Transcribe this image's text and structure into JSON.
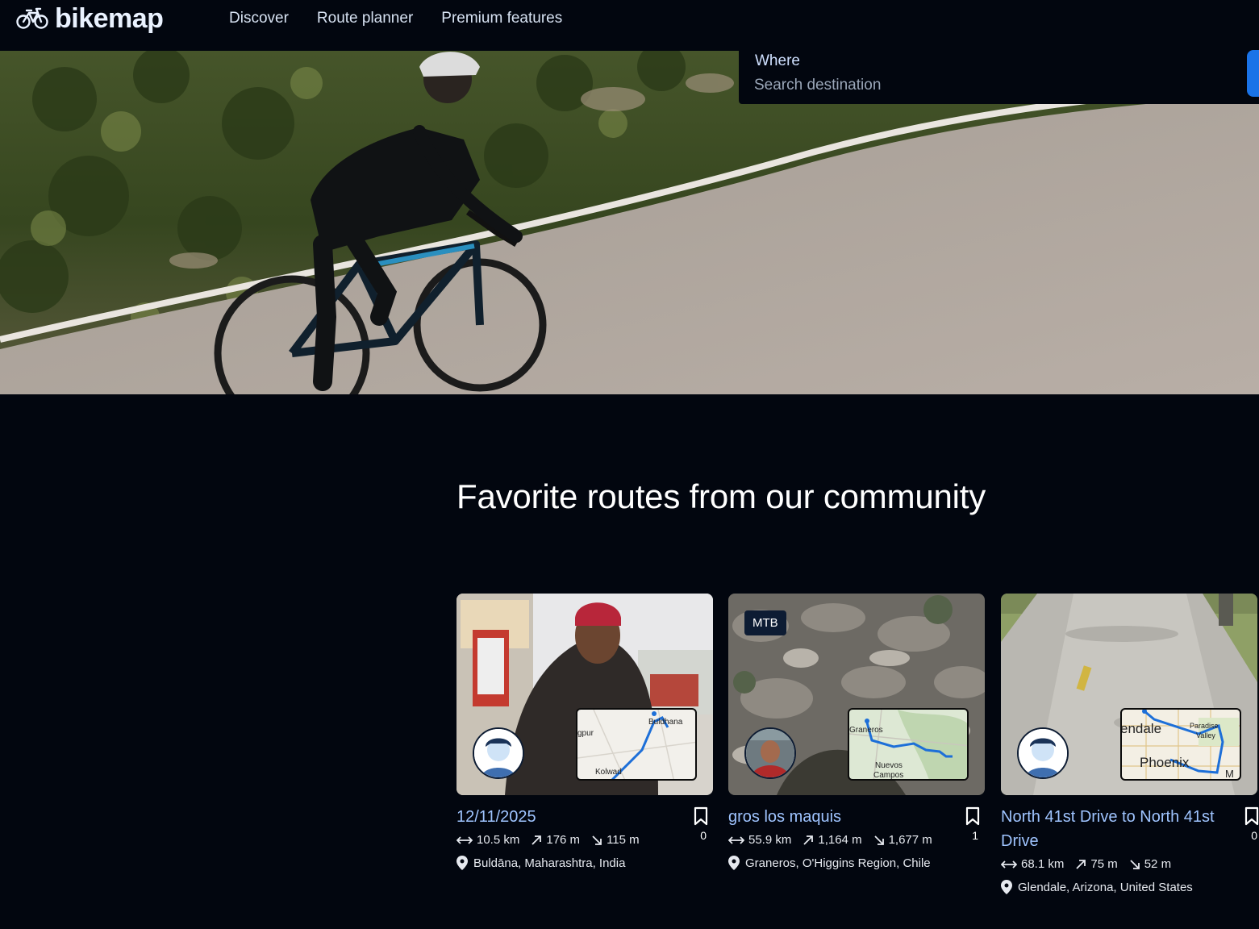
{
  "header": {
    "logo_text": "bikemap",
    "nav": [
      "Discover",
      "Route planner",
      "Premium features"
    ]
  },
  "search": {
    "label": "Where",
    "placeholder": "Search destination"
  },
  "section": {
    "title": "Favorite routes from our community"
  },
  "routes": [
    {
      "title": "12/11/2025",
      "badge": "",
      "distance": "10.5 km",
      "ascent": "176 m",
      "descent": "115 m",
      "location": "Buldāna, Maharashtra, India",
      "bookmarks": "0",
      "map_places": [
        "Buldhana",
        "gpur",
        "Kolwad"
      ]
    },
    {
      "title": "gros los maquis",
      "badge": "MTB",
      "distance": "55.9 km",
      "ascent": "1,164 m",
      "descent": "1,677 m",
      "location": "Graneros, O'Higgins Region, Chile",
      "bookmarks": "1",
      "map_places": [
        "Graneros",
        "Nuevos",
        "Campos"
      ]
    },
    {
      "title": "North 41st Drive to North 41st Drive",
      "badge": "",
      "distance": "68.1 km",
      "ascent": "75 m",
      "descent": "52 m",
      "location": "Glendale, Arizona, United States",
      "bookmarks": "0",
      "map_places": [
        "endale",
        "Paradise",
        "Valley",
        "Phoenix",
        "M"
      ]
    }
  ]
}
